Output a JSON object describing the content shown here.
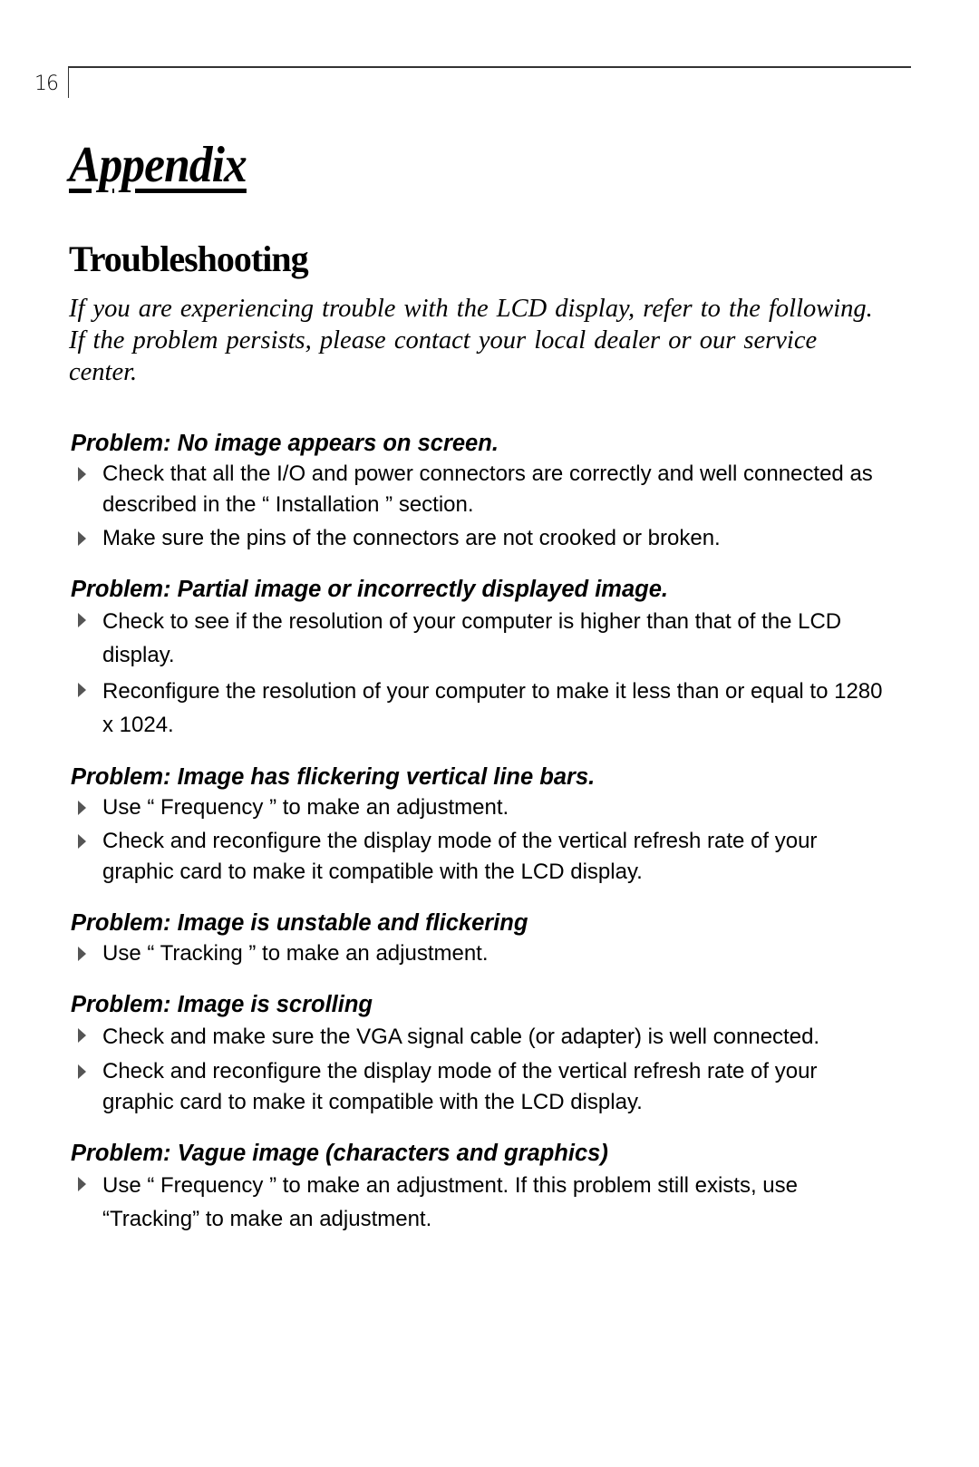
{
  "page": {
    "number": "16",
    "heading": "Appendix",
    "section_title": "Troubleshooting",
    "intro": "If you are experiencing trouble with the LCD display, refer to the following. If the problem persists, please contact your local dealer or our service center."
  },
  "problems": [
    {
      "title": "Problem: No image appears on screen.",
      "items": [
        "Check that all the I/O and power connectors are correctly and well connected as described in the “ Installation ” section.",
        "Make sure the pins of the connectors are not crooked or broken."
      ]
    },
    {
      "title": "Problem: Partial image or incorrectly displayed image.",
      "items": [
        "Check to see if the resolution of your computer is higher than that of the LCD display.",
        "Reconfigure the resolution of your computer to make it less than or equal to 1280 x 1024."
      ]
    },
    {
      "title": "Problem: Image has flickering vertical line bars.",
      "items": [
        "Use “ Frequency ” to make an adjustment.",
        "Check and reconfigure the display mode of the vertical refresh rate of your graphic card to make it compatible with the LCD display."
      ]
    },
    {
      "title": "Problem: Image is unstable and flickering",
      "items": [
        "Use “ Tracking ” to make an adjustment."
      ]
    },
    {
      "title": "Problem: Image is scrolling",
      "items": [
        "Check and make sure the VGA signal cable (or adapter) is well connected.",
        "Check and reconfigure the display mode of the vertical refresh rate of your graphic card to make it compatible with the LCD display."
      ]
    },
    {
      "title": "Problem: Vague image (characters and graphics)",
      "items": [
        "Use “ Frequency ” to make an adjustment. If this problem still exists, use “Tracking” to make an adjustment."
      ]
    }
  ]
}
